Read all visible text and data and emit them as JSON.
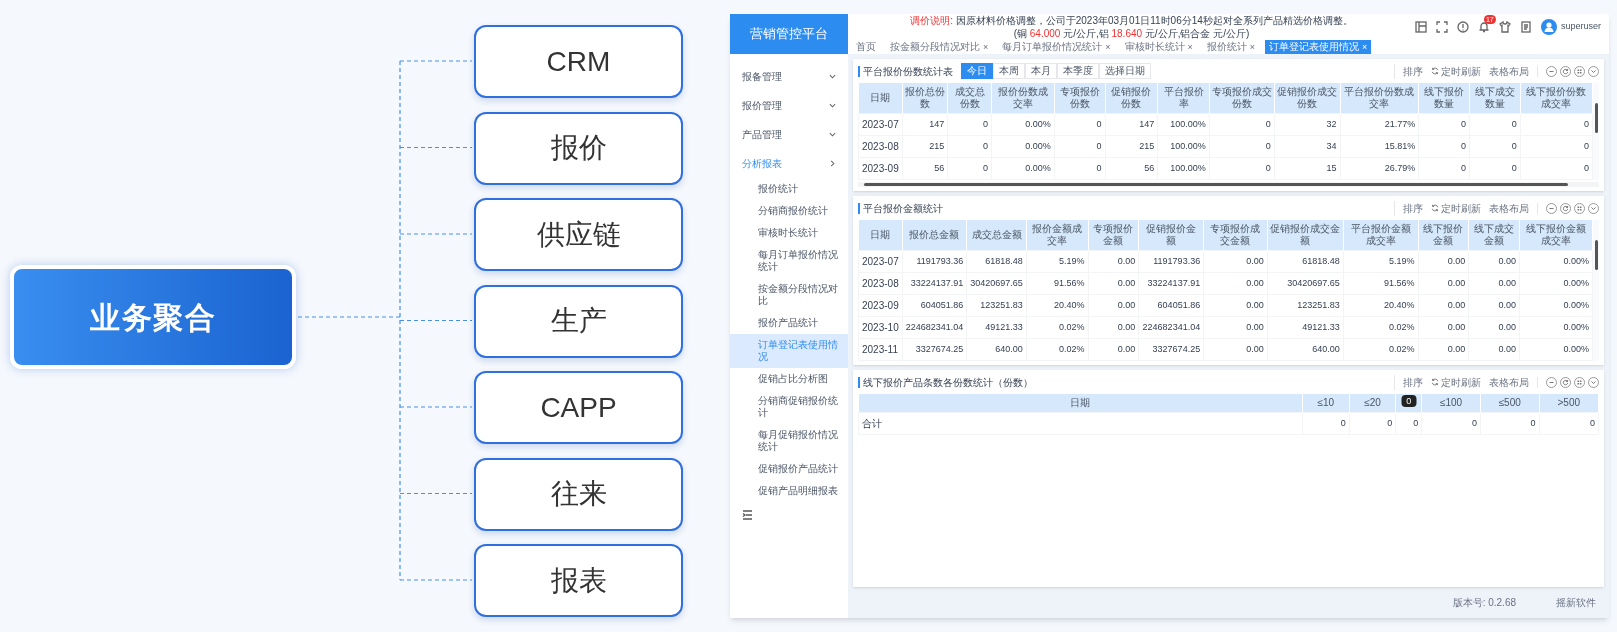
{
  "diagram": {
    "center": "业务聚合",
    "nodes": [
      "CRM",
      "报价",
      "供应链",
      "生产",
      "CAPP",
      "往来",
      "报表"
    ]
  },
  "app": {
    "logo": "营销管控平台",
    "notice": [
      [
        {
          "text": "调价说明:",
          "red": true
        },
        {
          "text": " 因原材料价格调整，公司于2023年03月01日11时06分14秒起对全系列产品精选价格调整。",
          "red": false
        }
      ],
      [
        {
          "text": "(铜 ",
          "red": false
        },
        {
          "text": "64.000",
          "red": true
        },
        {
          "text": " 元/公斤,铝 ",
          "red": false
        },
        {
          "text": "18.640",
          "red": true
        },
        {
          "text": " 元/公斤,铝合金  元/公斤)",
          "red": false
        }
      ]
    ],
    "badge": "17",
    "user": "superuser",
    "tabs": [
      {
        "label": "首页",
        "selected": false
      },
      {
        "label": "按金额分段情况对比",
        "close": "×",
        "selected": false
      },
      {
        "label": "每月订单报价情况统计",
        "close": "×",
        "selected": false
      },
      {
        "label": "审核时长统计",
        "close": "×",
        "selected": false
      },
      {
        "label": "报价统计",
        "close": "×",
        "selected": false
      },
      {
        "label": "订单登记表使用情况",
        "close": "×",
        "selected": true
      }
    ],
    "sidebar": [
      {
        "label": "报备管理",
        "expanded": false
      },
      {
        "label": "报价管理",
        "expanded": false
      },
      {
        "label": "产品管理",
        "expanded": false
      },
      {
        "label": "分析报表",
        "expanded": true,
        "children": [
          {
            "label": "报价统计",
            "selected": false
          },
          {
            "label": "分销商报价统计",
            "selected": false
          },
          {
            "label": "审核时长统计",
            "selected": false
          },
          {
            "label": "每月订单报价情况统计",
            "selected": false
          },
          {
            "label": "按金额分段情况对比",
            "selected": false
          },
          {
            "label": "报价产品统计",
            "selected": false
          },
          {
            "label": "订单登记表使用情况",
            "selected": true
          },
          {
            "label": "促销占比分析图",
            "selected": false
          },
          {
            "label": "分销商促销报价统计",
            "selected": false
          },
          {
            "label": "每月促销报价情况统计",
            "selected": false
          },
          {
            "label": "促销报价产品统计",
            "selected": false
          },
          {
            "label": "促销产品明细报表",
            "selected": false
          }
        ]
      }
    ],
    "cards": [
      {
        "title": "平台报价份数统计表",
        "range_tabs": [
          {
            "label": "今日",
            "selected": true
          },
          {
            "label": "本周",
            "selected": false
          },
          {
            "label": "本月",
            "selected": false
          },
          {
            "label": "本季度",
            "selected": false
          },
          {
            "label": "选择日期",
            "selected": false
          }
        ],
        "tools": [
          {
            "label": "排序",
            "kind": "plain"
          },
          {
            "label": "定时刷新",
            "kind": "refresh"
          },
          {
            "label": "表格布局",
            "kind": "plain"
          }
        ],
        "horizontal_scrollbar": true,
        "vertical_scrollbar": true,
        "columns": [
          {
            "label": "日期"
          },
          {
            "label": "报价总份数"
          },
          {
            "label": "成交总份数"
          },
          {
            "label": "报价份数成交率"
          },
          {
            "label": "专项报价份数"
          },
          {
            "label": "促销报价份数"
          },
          {
            "label": "平台报价率"
          },
          {
            "label": "专项报价成交份数"
          },
          {
            "label": "促销报价成交份数"
          },
          {
            "label": "平台报价份数成交率"
          },
          {
            "label": "线下报价数量"
          },
          {
            "label": "线下成交数量"
          },
          {
            "label": "线下报价份数成交率"
          }
        ],
        "rows": [
          [
            "2023-07",
            "147",
            "0",
            "0.00%",
            "0",
            "147",
            "100.00%",
            "0",
            "32",
            "21.77%",
            "0",
            "0",
            "0"
          ],
          [
            "2023-08",
            "215",
            "0",
            "0.00%",
            "0",
            "215",
            "100.00%",
            "0",
            "34",
            "15.81%",
            "0",
            "0",
            "0"
          ],
          [
            "2023-09",
            "56",
            "0",
            "0.00%",
            "0",
            "56",
            "100.00%",
            "0",
            "15",
            "26.79%",
            "0",
            "0",
            "0"
          ]
        ]
      },
      {
        "title": "平台报价金额统计",
        "tools": [
          {
            "label": "排序",
            "kind": "plain"
          },
          {
            "label": "定时刷新",
            "kind": "refresh"
          },
          {
            "label": "表格布局",
            "kind": "plain"
          }
        ],
        "horizontal_scrollbar": false,
        "vertical_scrollbar": true,
        "columns": [
          {
            "label": "日期"
          },
          {
            "label": "报价总金额"
          },
          {
            "label": "成交总金额"
          },
          {
            "label": "报价金额成交率"
          },
          {
            "label": "专项报价金额"
          },
          {
            "label": "促销报价金额"
          },
          {
            "label": "专项报价成交金额"
          },
          {
            "label": "促销报价成交金额"
          },
          {
            "label": "平台报价金额成交率"
          },
          {
            "label": "线下报价金额"
          },
          {
            "label": "线下成交金额"
          },
          {
            "label": "线下报价金额成交率"
          }
        ],
        "rows": [
          [
            "2023-07",
            "1191793.36",
            "61818.48",
            "5.19%",
            "0.00",
            "1191793.36",
            "0.00",
            "61818.48",
            "5.19%",
            "0.00",
            "0.00",
            "0.00%"
          ],
          [
            "2023-08",
            "33224137.91",
            "30420697.65",
            "91.56%",
            "0.00",
            "33224137.91",
            "0.00",
            "30420697.65",
            "91.56%",
            "0.00",
            "0.00",
            "0.00%"
          ],
          [
            "2023-09",
            "604051.86",
            "123251.83",
            "20.40%",
            "0.00",
            "604051.86",
            "0.00",
            "123251.83",
            "20.40%",
            "0.00",
            "0.00",
            "0.00%"
          ],
          [
            "2023-10",
            "224682341.04",
            "49121.33",
            "0.02%",
            "0.00",
            "224682341.04",
            "0.00",
            "49121.33",
            "0.02%",
            "0.00",
            "0.00",
            "0.00%"
          ],
          [
            "2023-11",
            "3327674.25",
            "640.00",
            "0.02%",
            "0.00",
            "3327674.25",
            "0.00",
            "640.00",
            "0.02%",
            "0.00",
            "0.00",
            "0.00%"
          ]
        ]
      },
      {
        "title": "线下报价产品条数各份数统计（份数）",
        "tools": [
          {
            "label": "排序",
            "kind": "plain"
          },
          {
            "label": "定时刷新",
            "kind": "refresh"
          },
          {
            "label": "表格布局",
            "kind": "plain"
          }
        ],
        "horizontal_scrollbar": false,
        "vertical_scrollbar": false,
        "columns": [
          {
            "label": "日期"
          },
          {
            "label": "≤10"
          },
          {
            "label": "≤20"
          },
          {
            "tooltip": "0"
          },
          {
            "label": "≤100"
          },
          {
            "label": "≤500"
          },
          {
            "label": ">500"
          }
        ],
        "rows": [
          [
            "合计",
            "0",
            "0",
            "0",
            "0",
            "0",
            "0"
          ]
        ]
      }
    ],
    "footer": {
      "version": "版本号: 0.2.68",
      "company": "摇新软件"
    }
  }
}
